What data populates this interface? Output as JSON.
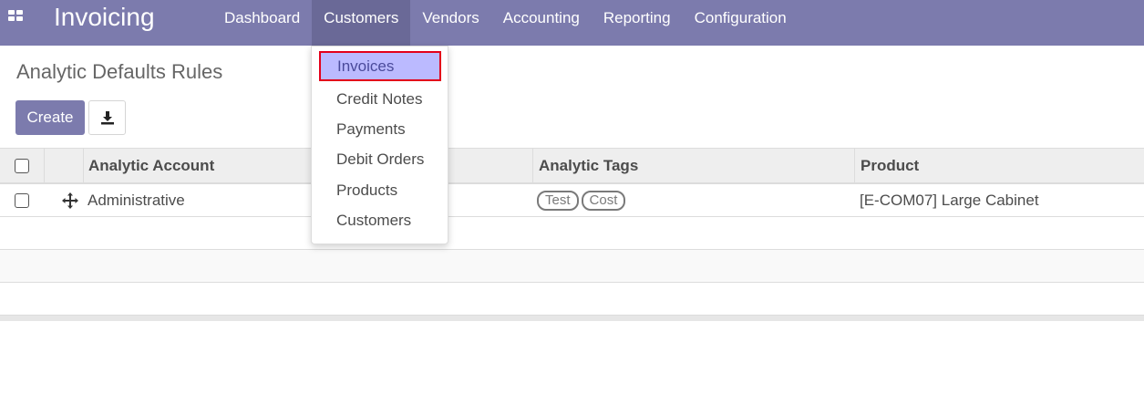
{
  "navbar": {
    "app_title": "Invoicing",
    "menu": [
      {
        "label": "Dashboard"
      },
      {
        "label": "Customers",
        "active": true
      },
      {
        "label": "Vendors"
      },
      {
        "label": "Accounting"
      },
      {
        "label": "Reporting"
      },
      {
        "label": "Configuration"
      }
    ],
    "accent_color": "#7c7bad"
  },
  "control_panel": {
    "title": "Analytic Defaults Rules",
    "create_label": "Create",
    "download_icon": "download-icon"
  },
  "table": {
    "columns": [
      "Analytic Account",
      "Analytic Tags",
      "Product"
    ],
    "rows": [
      {
        "analytic_account": "Administrative",
        "tags": [
          "Test",
          "Cost"
        ],
        "product": "[E-COM07] Large Cabinet"
      }
    ]
  },
  "dropdown": {
    "items": [
      {
        "label": "Invoices",
        "highlighted": true
      },
      {
        "label": "Credit Notes"
      },
      {
        "label": "Payments"
      },
      {
        "label": "Debit Orders"
      },
      {
        "label": "Products"
      },
      {
        "label": "Customers"
      }
    ],
    "highlight_color": "#bbbaff",
    "highlight_border": "#e3001b"
  }
}
